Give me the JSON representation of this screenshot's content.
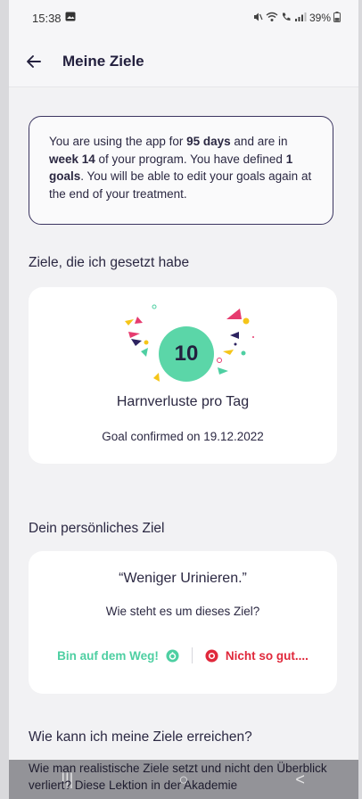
{
  "status_bar": {
    "time": "15:38",
    "battery": "39%",
    "icons": [
      "gallery-icon",
      "mute-icon",
      "wifi-icon",
      "call-icon",
      "signal-icon",
      "battery-icon"
    ]
  },
  "app_bar": {
    "title": "Meine Ziele",
    "back_icon": "arrow-left-icon"
  },
  "info": {
    "part1": "You are using the app for ",
    "days": "95 days",
    "part2": " and are in ",
    "week": "week 14",
    "part3": " of your program. You have defined ",
    "goals_count": "1",
    "goals_word": " goals",
    "part4": ". You will be able to edit your goals again at the end of your treatment."
  },
  "goals_section": {
    "label": "Ziele, die ich gesetzt habe",
    "goal": {
      "value": "10",
      "title": "Harnverluste pro Tag",
      "confirmed": "Goal confirmed on 19.12.2022"
    }
  },
  "personal_section": {
    "label": "Dein persönliches Ziel",
    "quote": "“Weniger Urinieren.”",
    "question": "Wie steht es um dieses Ziel?",
    "good_label": "Bin auf dem Weg!",
    "bad_label": "Nicht so gut....",
    "colors": {
      "good": "#4ecfa2",
      "bad": "#e0283b"
    }
  },
  "how_section": {
    "label": "Wie kann ich meine Ziele erreichen?",
    "text": "Wie man realistische Ziele setzt und nicht den Überblick verliert? Diese Lektion in der Akademie"
  },
  "nav_bar": {
    "recent": "|||",
    "home": "○",
    "back": "<"
  }
}
